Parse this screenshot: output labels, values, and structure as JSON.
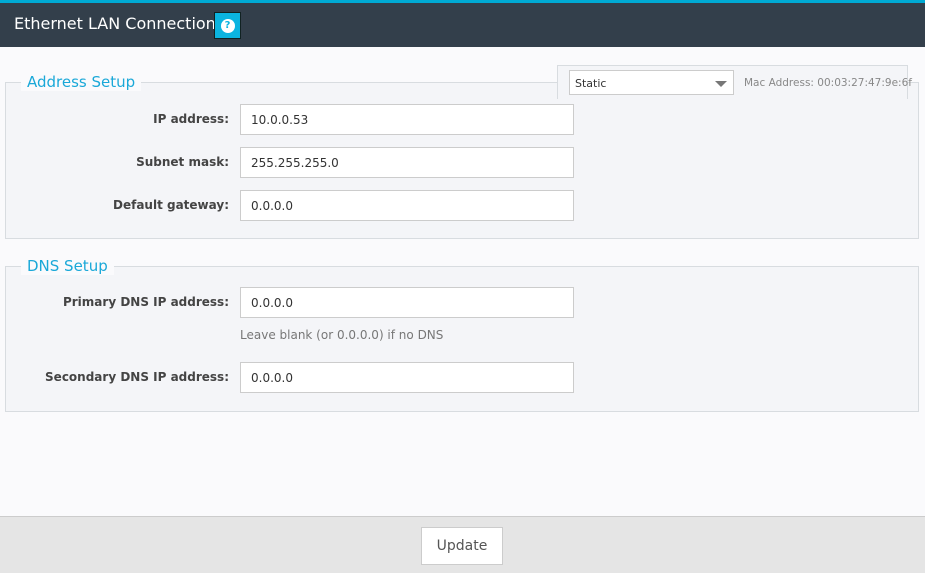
{
  "header": {
    "title": "Ethernet LAN Connection",
    "help_icon": "question-circle-icon"
  },
  "address": {
    "legend": "Address Setup",
    "mode": "Static",
    "mac": "Mac Address: 00:03:27:47:9e:6f",
    "fields": [
      {
        "label": "IP address:",
        "value": "10.0.0.53"
      },
      {
        "label": "Subnet mask:",
        "value": "255.255.255.0"
      },
      {
        "label": "Default gateway:",
        "value": "0.0.0.0"
      }
    ]
  },
  "dns": {
    "legend": "DNS Setup",
    "primary": {
      "label": "Primary DNS IP address:",
      "value": "0.0.0.0",
      "hint": "Leave blank (or 0.0.0.0) if no DNS"
    },
    "secondary": {
      "label": "Secondary DNS IP address:",
      "value": "0.0.0.0"
    }
  },
  "footer": {
    "update": "Update"
  },
  "colors": {
    "accent": "#00aad4",
    "header_bg": "#333f4b"
  }
}
